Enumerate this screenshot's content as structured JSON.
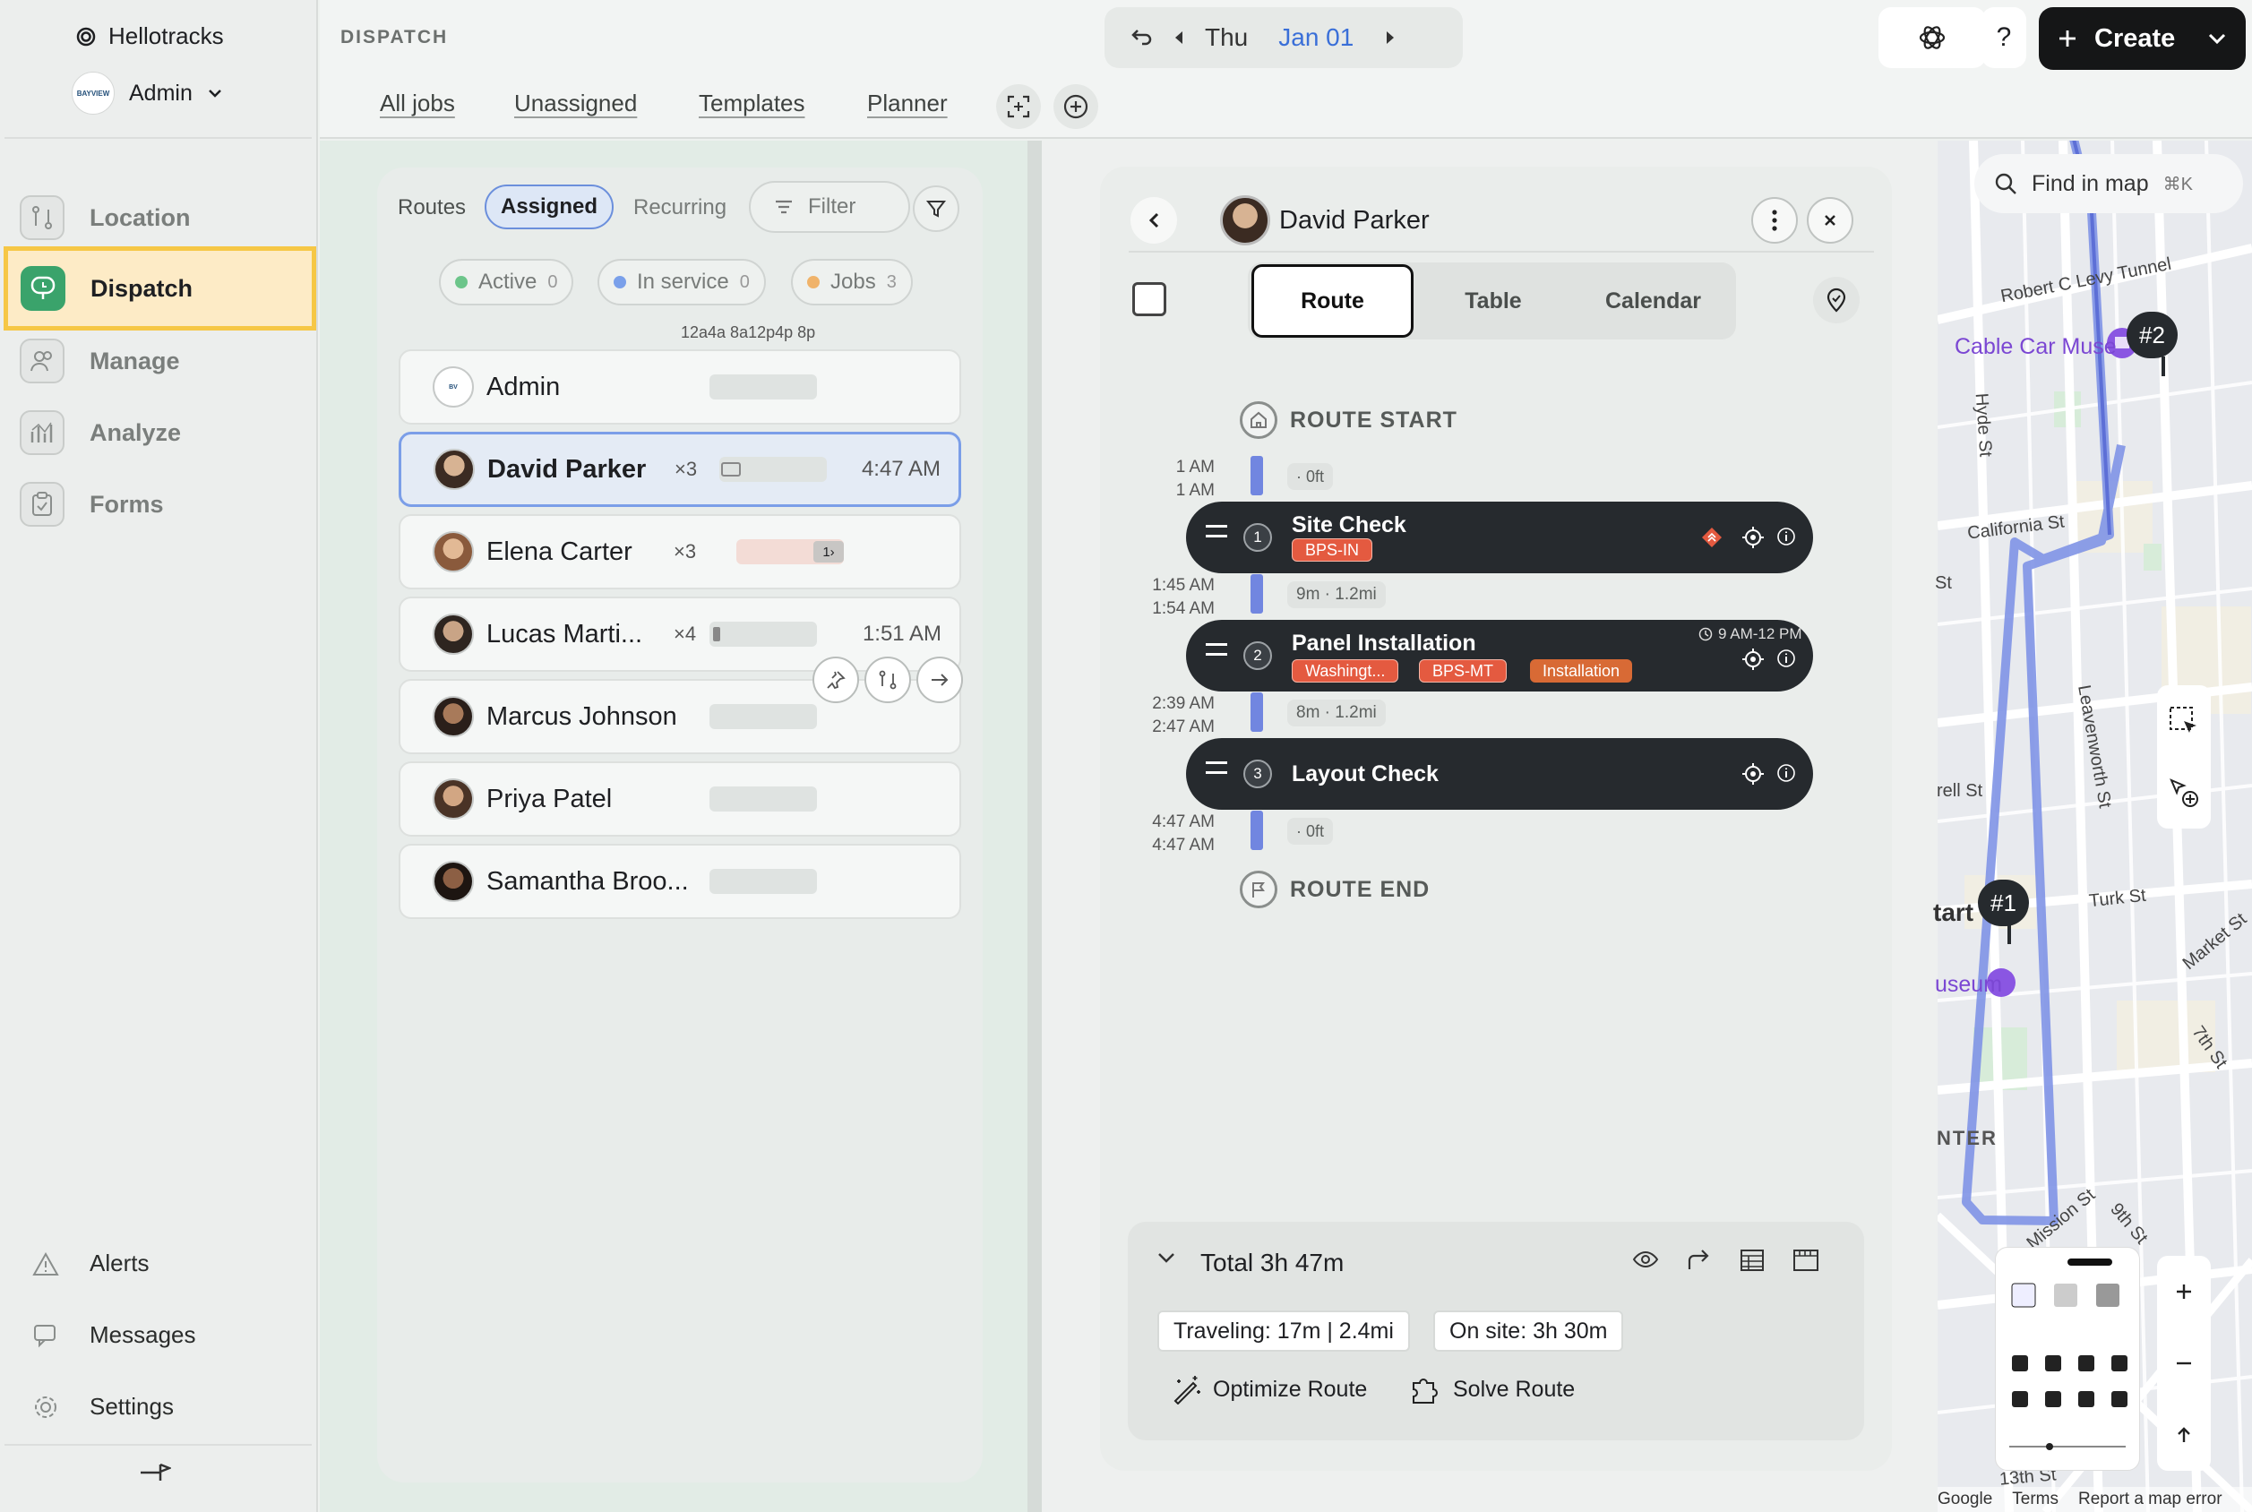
{
  "sidebar": {
    "brand": "Hellotracks",
    "org_name": "Admin",
    "org_logo_text": "BAYVIEW",
    "nav": [
      {
        "label": "Location",
        "icon": "location-icon"
      },
      {
        "label": "Dispatch",
        "icon": "dispatch-icon"
      },
      {
        "label": "Manage",
        "icon": "manage-icon"
      },
      {
        "label": "Analyze",
        "icon": "analyze-icon"
      },
      {
        "label": "Forms",
        "icon": "forms-icon"
      }
    ],
    "bottom_nav": [
      {
        "label": "Alerts",
        "icon": "alert-icon"
      },
      {
        "label": "Messages",
        "icon": "messages-icon"
      },
      {
        "label": "Settings",
        "icon": "settings-icon"
      }
    ]
  },
  "header": {
    "breadcrumb": "DISPATCH",
    "day": "Thu",
    "date": "Jan 01",
    "tabs": [
      "All jobs",
      "Unassigned",
      "Templates",
      "Planner"
    ],
    "help_label": "?",
    "create_label": "Create"
  },
  "routes": {
    "tabs": {
      "routes": "Routes",
      "assigned": "Assigned",
      "recurring": "Recurring"
    },
    "filter_label": "Filter",
    "status": [
      {
        "label": "Active",
        "count": "0",
        "color": "#6cc58a"
      },
      {
        "label": "In service",
        "count": "0",
        "color": "#7aa0ea"
      },
      {
        "label": "Jobs",
        "count": "3",
        "color": "#f0b36a"
      }
    ],
    "timeline_labels": "12a4a 8a12p4p 8p",
    "people": [
      {
        "name": "Admin",
        "count": "",
        "time": ""
      },
      {
        "name": "David Parker",
        "count": "×3",
        "time": "4:47 AM"
      },
      {
        "name": "Elena Carter",
        "count": "×3",
        "time": "",
        "bar_label": "1›"
      },
      {
        "name": "Lucas Marti...",
        "count": "×4",
        "time": "1:51 AM"
      },
      {
        "name": "Marcus Johnson",
        "count": "",
        "time": ""
      },
      {
        "name": "Priya Patel",
        "count": "",
        "time": ""
      },
      {
        "name": "Samantha Broo...",
        "count": "",
        "time": ""
      }
    ]
  },
  "detail": {
    "name": "David Parker",
    "views": [
      "Route",
      "Table",
      "Calendar"
    ],
    "route_start": "ROUTE START",
    "route_end": "ROUTE END",
    "start_times": [
      "1 AM",
      "1 AM"
    ],
    "start_gap": "· 0ft",
    "stops": [
      {
        "number": "1",
        "title": "Site Check",
        "tags": [
          "BPS-IN"
        ],
        "times": [
          "1:45 AM",
          "1:54 AM"
        ],
        "gap_after": "9m · 1.2mi",
        "window": ""
      },
      {
        "number": "2",
        "title": "Panel Installation",
        "tags": [
          "Washingt...",
          "BPS-MT",
          "Installation"
        ],
        "times": [
          "2:39 AM",
          "2:47 AM"
        ],
        "gap_after": "8m · 1.2mi",
        "window": "9 AM-12 PM"
      },
      {
        "number": "3",
        "title": "Layout Check",
        "tags": [],
        "times": [
          "4:47 AM",
          "4:47 AM"
        ],
        "gap_after": "· 0ft",
        "window": ""
      }
    ],
    "summary": {
      "total": "Total 3h 47m",
      "traveling": "Traveling: 17m | 2.4mi",
      "onsite": "On site: 3h 30m",
      "optimize": "Optimize Route",
      "solve": "Solve Route"
    }
  },
  "map": {
    "search_placeholder": "Find in map",
    "search_shortcut": "⌘K",
    "streets": [
      "Robert C Levy Tunnel",
      "Hyde St",
      "California St",
      "Leavenworth St",
      "Turk St",
      "Market St",
      "7th St",
      "Mission St",
      "9th St",
      "13th St"
    ],
    "places": [
      "Cable Car Muse",
      "useum",
      "NTER",
      "tart",
      "St",
      "rell St"
    ],
    "pins": [
      "#2",
      "#1"
    ],
    "footer": [
      "Google",
      "Terms",
      "Report a map error"
    ],
    "route_color": "#7f93e6"
  }
}
